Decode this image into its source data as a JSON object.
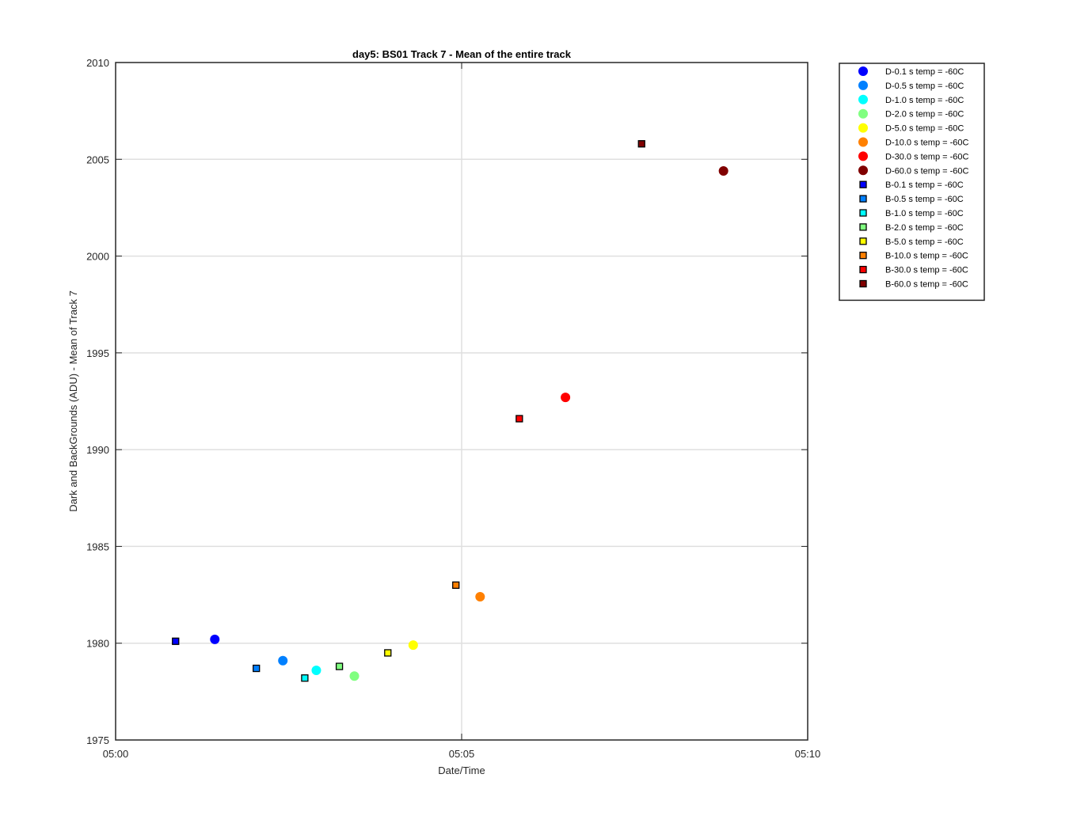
{
  "chart_data": {
    "type": "scatter",
    "title": "day5: BS01  Track 7 - Mean of the entire track",
    "xlabel": "Date/Time",
    "ylabel": "Dark and BackGrounds (ADU) - Mean of Track 7",
    "x_unit": "time HH:MM",
    "xlim": [
      "05:00",
      "05:10"
    ],
    "ylim": [
      1975,
      2010
    ],
    "x_ticks": [
      "05:00",
      "05:05",
      "05:10"
    ],
    "y_ticks": [
      1975,
      1980,
      1985,
      1990,
      1995,
      2000,
      2005,
      2010
    ],
    "grid": true,
    "legend_position": "outside-top-right",
    "series": [
      {
        "name": "D-0.1 s temp = -60C",
        "marker": "circle",
        "color": "#0000ff",
        "x": [
          "05:01:26"
        ],
        "y": [
          1980.2
        ]
      },
      {
        "name": "D-0.5 s temp = -60C",
        "marker": "circle",
        "color": "#0080ff",
        "x": [
          "05:02:25"
        ],
        "y": [
          1979.1
        ]
      },
      {
        "name": "D-1.0 s temp = -60C",
        "marker": "circle",
        "color": "#00ffff",
        "x": [
          "05:02:54"
        ],
        "y": [
          1978.6
        ]
      },
      {
        "name": "D-2.0 s temp = -60C",
        "marker": "circle",
        "color": "#80ff80",
        "x": [
          "05:03:27"
        ],
        "y": [
          1978.3
        ]
      },
      {
        "name": "D-5.0 s temp = -60C",
        "marker": "circle",
        "color": "#ffff00",
        "x": [
          "05:04:18"
        ],
        "y": [
          1979.9
        ]
      },
      {
        "name": "D-10.0 s temp = -60C",
        "marker": "circle",
        "color": "#ff8000",
        "x": [
          "05:05:16"
        ],
        "y": [
          1982.4
        ]
      },
      {
        "name": "D-30.0 s temp = -60C",
        "marker": "circle",
        "color": "#ff0000",
        "x": [
          "05:06:30"
        ],
        "y": [
          1992.7
        ]
      },
      {
        "name": "D-60.0 s temp = -60C",
        "marker": "circle",
        "color": "#800000",
        "x": [
          "05:08:47"
        ],
        "y": [
          2004.4
        ]
      },
      {
        "name": "B-0.1 s temp = -60C",
        "marker": "square",
        "color": "#0000ff",
        "x": [
          "05:00:52"
        ],
        "y": [
          1980.1
        ]
      },
      {
        "name": "B-0.5 s temp = -60C",
        "marker": "square",
        "color": "#0080ff",
        "x": [
          "05:02:02"
        ],
        "y": [
          1978.7
        ]
      },
      {
        "name": "B-1.0 s temp = -60C",
        "marker": "square",
        "color": "#00ffff",
        "x": [
          "05:02:44"
        ],
        "y": [
          1978.2
        ]
      },
      {
        "name": "B-2.0 s temp = -60C",
        "marker": "square",
        "color": "#80ff80",
        "x": [
          "05:03:14"
        ],
        "y": [
          1978.8
        ]
      },
      {
        "name": "B-5.0 s temp = -60C",
        "marker": "square",
        "color": "#ffff00",
        "x": [
          "05:03:56"
        ],
        "y": [
          1979.5
        ]
      },
      {
        "name": "B-10.0 s temp = -60C",
        "marker": "square",
        "color": "#ff8000",
        "x": [
          "05:04:55"
        ],
        "y": [
          1983.0
        ]
      },
      {
        "name": "B-30.0 s temp = -60C",
        "marker": "square",
        "color": "#ff0000",
        "x": [
          "05:05:50"
        ],
        "y": [
          1991.6
        ]
      },
      {
        "name": "B-60.0 s temp = -60C",
        "marker": "square",
        "color": "#800000",
        "x": [
          "05:07:36"
        ],
        "y": [
          2005.8
        ]
      }
    ]
  }
}
